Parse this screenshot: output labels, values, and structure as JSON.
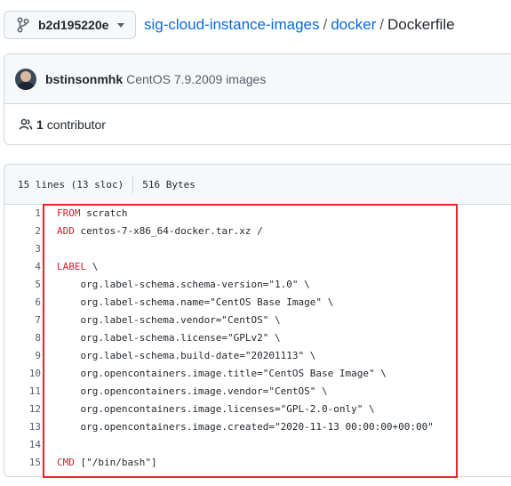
{
  "branch": {
    "name": "b2d195220e"
  },
  "breadcrumb": {
    "repo": "sig-cloud-instance-images",
    "sep1": "/",
    "folder": "docker",
    "sep2": "/",
    "file": "Dockerfile"
  },
  "commit": {
    "author": "bstinsonmhk",
    "message": "CentOS 7.9.2009 images"
  },
  "contributors": {
    "count": "1",
    "label": "contributor"
  },
  "file_info": {
    "lines": "15 lines (13 sloc)",
    "size": "516 Bytes"
  },
  "code": {
    "lines": [
      {
        "num": "1",
        "keyword": "FROM",
        "rest": " scratch"
      },
      {
        "num": "2",
        "keyword": "ADD",
        "rest": " centos-7-x86_64-docker.tar.xz /"
      },
      {
        "num": "3",
        "keyword": "",
        "rest": ""
      },
      {
        "num": "4",
        "keyword": "LABEL",
        "rest": " \\"
      },
      {
        "num": "5",
        "keyword": "",
        "rest": "    org.label-schema.schema-version=\"1.0\" \\"
      },
      {
        "num": "6",
        "keyword": "",
        "rest": "    org.label-schema.name=\"CentOS Base Image\" \\"
      },
      {
        "num": "7",
        "keyword": "",
        "rest": "    org.label-schema.vendor=\"CentOS\" \\"
      },
      {
        "num": "8",
        "keyword": "",
        "rest": "    org.label-schema.license=\"GPLv2\" \\"
      },
      {
        "num": "9",
        "keyword": "",
        "rest": "    org.label-schema.build-date=\"20201113\" \\"
      },
      {
        "num": "10",
        "keyword": "",
        "rest": "    org.opencontainers.image.title=\"CentOS Base Image\" \\"
      },
      {
        "num": "11",
        "keyword": "",
        "rest": "    org.opencontainers.image.vendor=\"CentOS\" \\"
      },
      {
        "num": "12",
        "keyword": "",
        "rest": "    org.opencontainers.image.licenses=\"GPL-2.0-only\" \\"
      },
      {
        "num": "13",
        "keyword": "",
        "rest": "    org.opencontainers.image.created=\"2020-11-13 00:00:00+00:00\""
      },
      {
        "num": "14",
        "keyword": "",
        "rest": ""
      },
      {
        "num": "15",
        "keyword": "CMD",
        "rest": " [\"/bin/bash\"]"
      }
    ]
  },
  "colors": {
    "accent_link": "#0969da",
    "keyword": "#cf222e",
    "annotation_border": "#e5252a"
  }
}
